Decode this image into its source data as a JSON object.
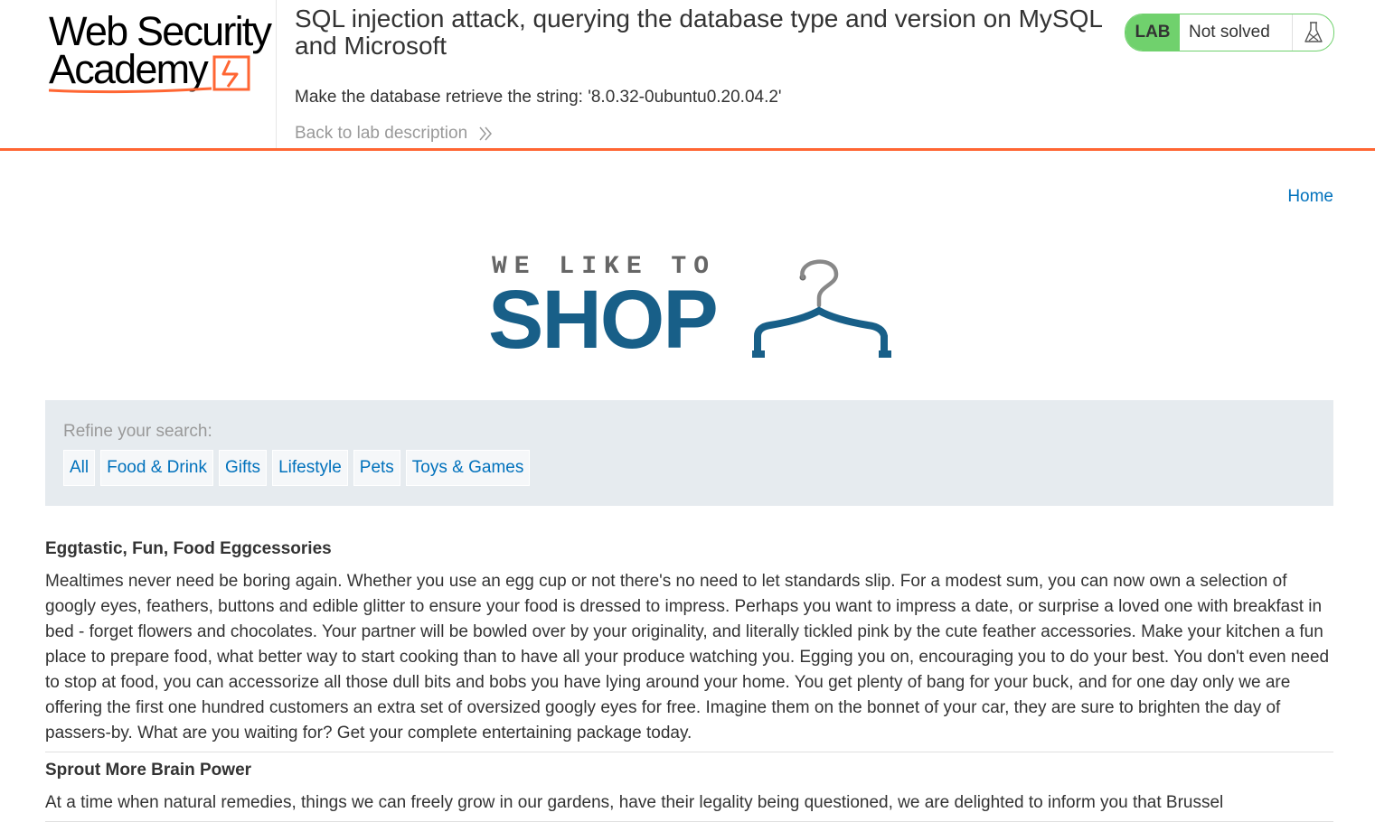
{
  "header": {
    "logo_line1": "Web Security",
    "logo_line2": "Academy",
    "lab_title": "SQL injection attack, querying the database type and version on MySQL and Microsoft",
    "lab_goal": "Make the database retrieve the string: '8.0.32-0ubuntu0.20.04.2'",
    "back_link": "Back to lab description",
    "lab_badge": "LAB",
    "lab_status": "Not solved",
    "accent_color": "#ff6633",
    "status_color": "#70d16d"
  },
  "nav": {
    "home": "Home"
  },
  "shop_logo": {
    "tagline": "WE LIKE TO",
    "name": "SHOP",
    "icon": "hanger-icon",
    "color": "#185f88"
  },
  "filter": {
    "label": "Refine your search:",
    "categories": [
      "All",
      "Food & Drink",
      "Gifts",
      "Lifestyle",
      "Pets",
      "Toys & Games"
    ]
  },
  "products": [
    {
      "title": "Eggtastic, Fun, Food Eggcessories",
      "description": "Mealtimes never need be boring again. Whether you use an egg cup or not there's no need to let standards slip. For a modest sum, you can now own a selection of googly eyes, feathers, buttons and edible glitter to ensure your food is dressed to impress. Perhaps you want to impress a date, or surprise a loved one with breakfast in bed - forget flowers and chocolates. Your partner will be bowled over by your originality, and literally tickled pink by the cute feather accessories. Make your kitchen a fun place to prepare food, what better way to start cooking than to have all your produce watching you. Egging you on, encouraging you to do your best. You don't even need to stop at food, you can accessorize all those dull bits and bobs you have lying around your home. You get plenty of bang for your buck, and for one day only we are offering the first one hundred customers an extra set of oversized googly eyes for free. Imagine them on the bonnet of your car, they are sure to brighten the day of passers-by. What are you waiting for? Get your complete entertaining package today."
    },
    {
      "title": "Sprout More Brain Power",
      "description": "At a time when natural remedies, things we can freely grow in our gardens, have their legality being questioned, we are delighted to inform you that Brussel"
    }
  ]
}
